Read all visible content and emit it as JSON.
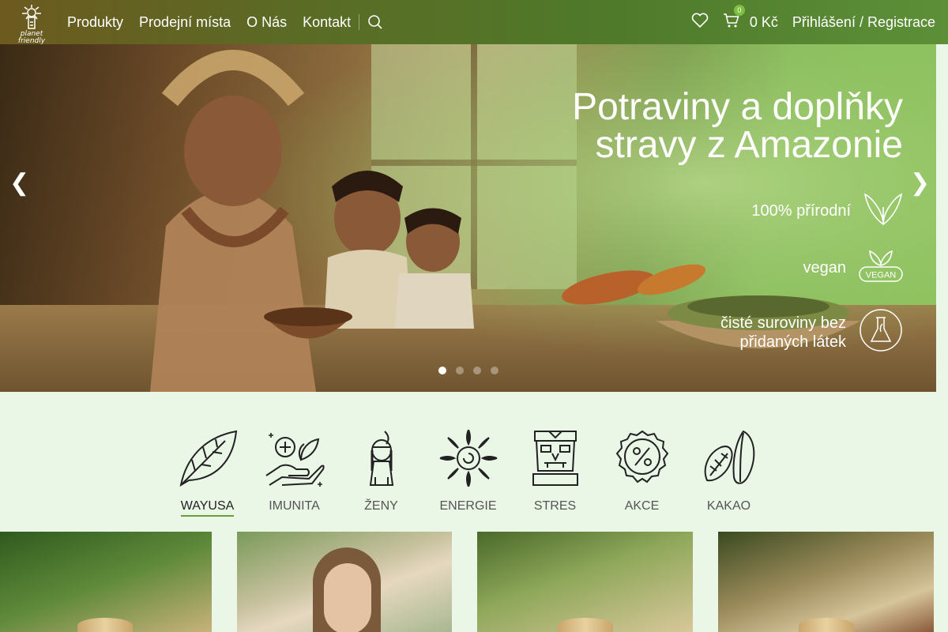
{
  "brand": {
    "logo_text": "planet friendly"
  },
  "nav": {
    "items": [
      "Produkty",
      "Prodejní místa",
      "O Nás",
      "Kontakt"
    ]
  },
  "header": {
    "wishlist_icon": "heart-icon",
    "cart_count": "0",
    "cart_total": "0 Kč",
    "login_label": "Přihlášení / Registrace"
  },
  "hero": {
    "title_line1": "Potraviny a doplňky",
    "title_line2": "stravy z Amazonie",
    "features": [
      {
        "label": "100% přírodní",
        "icon": "leaf-icon"
      },
      {
        "label": "vegan",
        "icon": "vegan-icon",
        "icon_text": "VEGAN"
      },
      {
        "label_line1": "čisté suroviny bez",
        "label_line2": "přidaných látek",
        "icon": "flask-icon"
      }
    ],
    "slides": 4,
    "active_slide": 1
  },
  "categories": [
    {
      "label": "WAYUSA",
      "icon": "leaf-icon",
      "active": true
    },
    {
      "label": "IMUNITA",
      "icon": "hand-plant-icon"
    },
    {
      "label": "ŽENY",
      "icon": "woman-icon"
    },
    {
      "label": "ENERGIE",
      "icon": "sun-icon"
    },
    {
      "label": "STRES",
      "icon": "totem-icon"
    },
    {
      "label": "AKCE",
      "icon": "percent-badge-icon"
    },
    {
      "label": "KAKAO",
      "icon": "cacao-pod-icon"
    }
  ],
  "colors": {
    "accent": "#6b9b3a",
    "header_bg": "#4f7a2a",
    "page_bg": "#eaf6e6"
  }
}
